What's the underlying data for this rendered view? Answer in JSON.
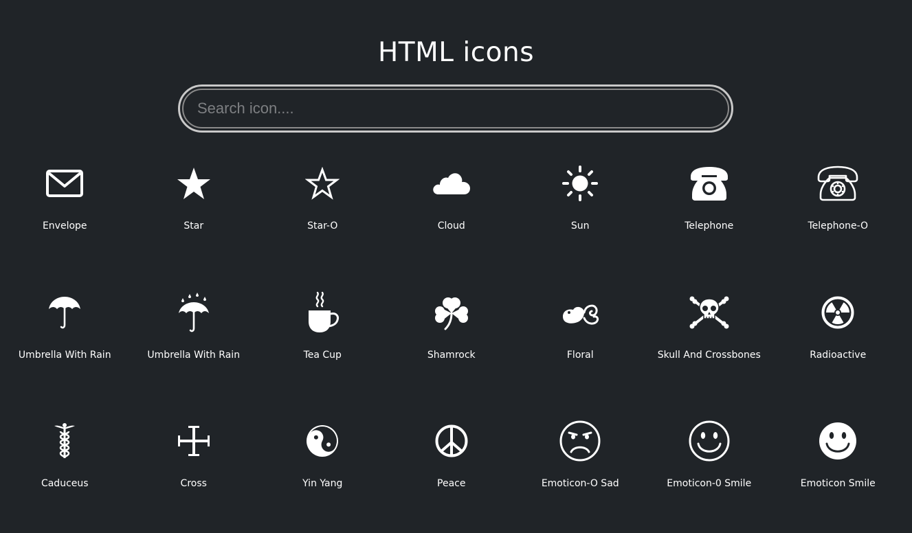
{
  "header": {
    "title": "HTML icons"
  },
  "search": {
    "placeholder": "Search icon...."
  },
  "icons": [
    {
      "name": "envelope-icon",
      "label": "Envelope"
    },
    {
      "name": "star-icon",
      "label": "Star"
    },
    {
      "name": "star-outline-icon",
      "label": "Star-O"
    },
    {
      "name": "cloud-icon",
      "label": "Cloud"
    },
    {
      "name": "sun-icon",
      "label": "Sun"
    },
    {
      "name": "telephone-icon",
      "label": "Telephone"
    },
    {
      "name": "telephone-outline-icon",
      "label": "Telephone-O"
    },
    {
      "name": "umbrella-icon",
      "label": "Umbrella With Rain"
    },
    {
      "name": "umbrella-rain-icon",
      "label": "Umbrella With Rain"
    },
    {
      "name": "tea-cup-icon",
      "label": "Tea Cup"
    },
    {
      "name": "shamrock-icon",
      "label": "Shamrock"
    },
    {
      "name": "floral-icon",
      "label": "Floral"
    },
    {
      "name": "skull-crossbones-icon",
      "label": "Skull And Crossbones"
    },
    {
      "name": "radioactive-icon",
      "label": "Radioactive"
    },
    {
      "name": "caduceus-icon",
      "label": "Caduceus"
    },
    {
      "name": "cross-icon",
      "label": "Cross"
    },
    {
      "name": "yin-yang-icon",
      "label": "Yin Yang"
    },
    {
      "name": "peace-icon",
      "label": "Peace"
    },
    {
      "name": "emoticon-sad-outline-icon",
      "label": "Emoticon-O Sad"
    },
    {
      "name": "emoticon-smile-outline-icon",
      "label": "Emoticon-0 Smile"
    },
    {
      "name": "emoticon-smile-icon",
      "label": "Emoticon Smile"
    }
  ]
}
